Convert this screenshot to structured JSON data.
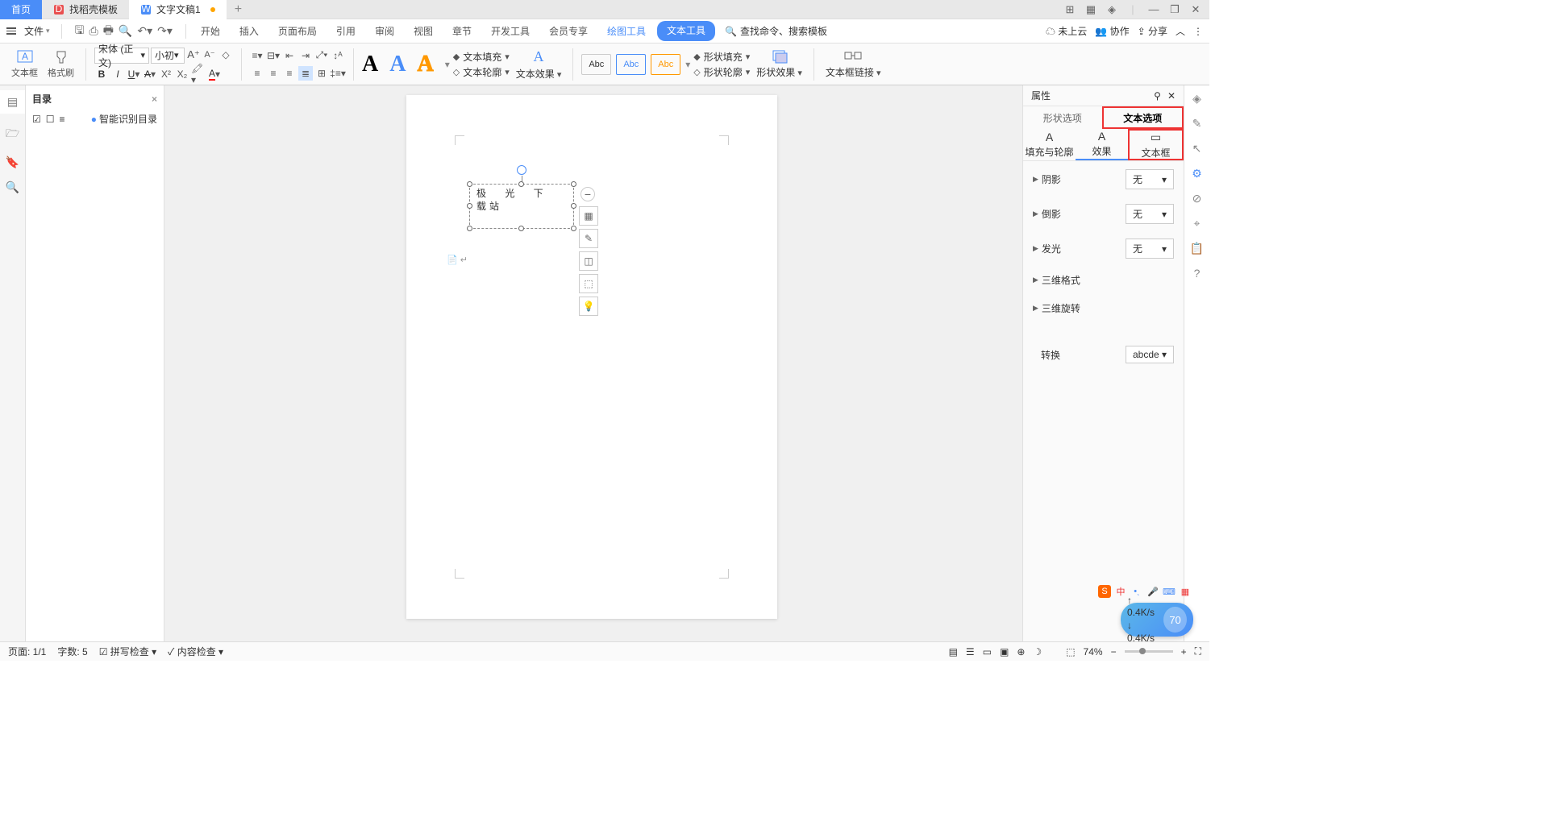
{
  "tabs": {
    "home": "首页",
    "template": "找稻壳模板",
    "doc": "文字文稿1"
  },
  "menubar": {
    "file": "文件",
    "items": [
      "开始",
      "插入",
      "页面布局",
      "引用",
      "审阅",
      "视图",
      "章节",
      "开发工具",
      "会员专享"
    ],
    "draw": "绘图工具",
    "text": "文本工具",
    "search": "查找命令、搜索模板"
  },
  "menuright": {
    "cloud": "未上云",
    "collab": "协作",
    "share": "分享"
  },
  "ribbon": {
    "textbox": "文本框",
    "brush": "格式刷",
    "font": "宋体 (正文)",
    "size": "小初",
    "fill": "文本填充",
    "outline": "文本轮廓",
    "effect": "文本效果",
    "shapefill": "形状填充",
    "shapeoutline": "形状轮廓",
    "shapeeffect": "形状效果",
    "link": "文本框链接",
    "abc": "Abc"
  },
  "toc": {
    "title": "目录",
    "smart": "智能识别目录"
  },
  "textbox_content": {
    "line1": "极 光 下",
    "line2": "载站"
  },
  "prop": {
    "title": "属性",
    "shape_tab": "形状选项",
    "text_tab": "文本选项",
    "sub1": "填充与轮廓",
    "sub2": "效果",
    "sub3": "文本框",
    "shadow": "阴影",
    "reflect": "倒影",
    "glow": "发光",
    "format3d": "三维格式",
    "rotate3d": "三维旋转",
    "transform": "转换",
    "none": "无",
    "abcde": "abcde"
  },
  "status": {
    "page": "页面: 1/1",
    "words": "字数: 5",
    "spell": "拼写检查",
    "content": "内容检查",
    "zoom": "74%"
  },
  "net": {
    "up": "0.4K/s",
    "down": "0.4K/s",
    "val": "70"
  },
  "ime": {
    "zh": "中"
  }
}
